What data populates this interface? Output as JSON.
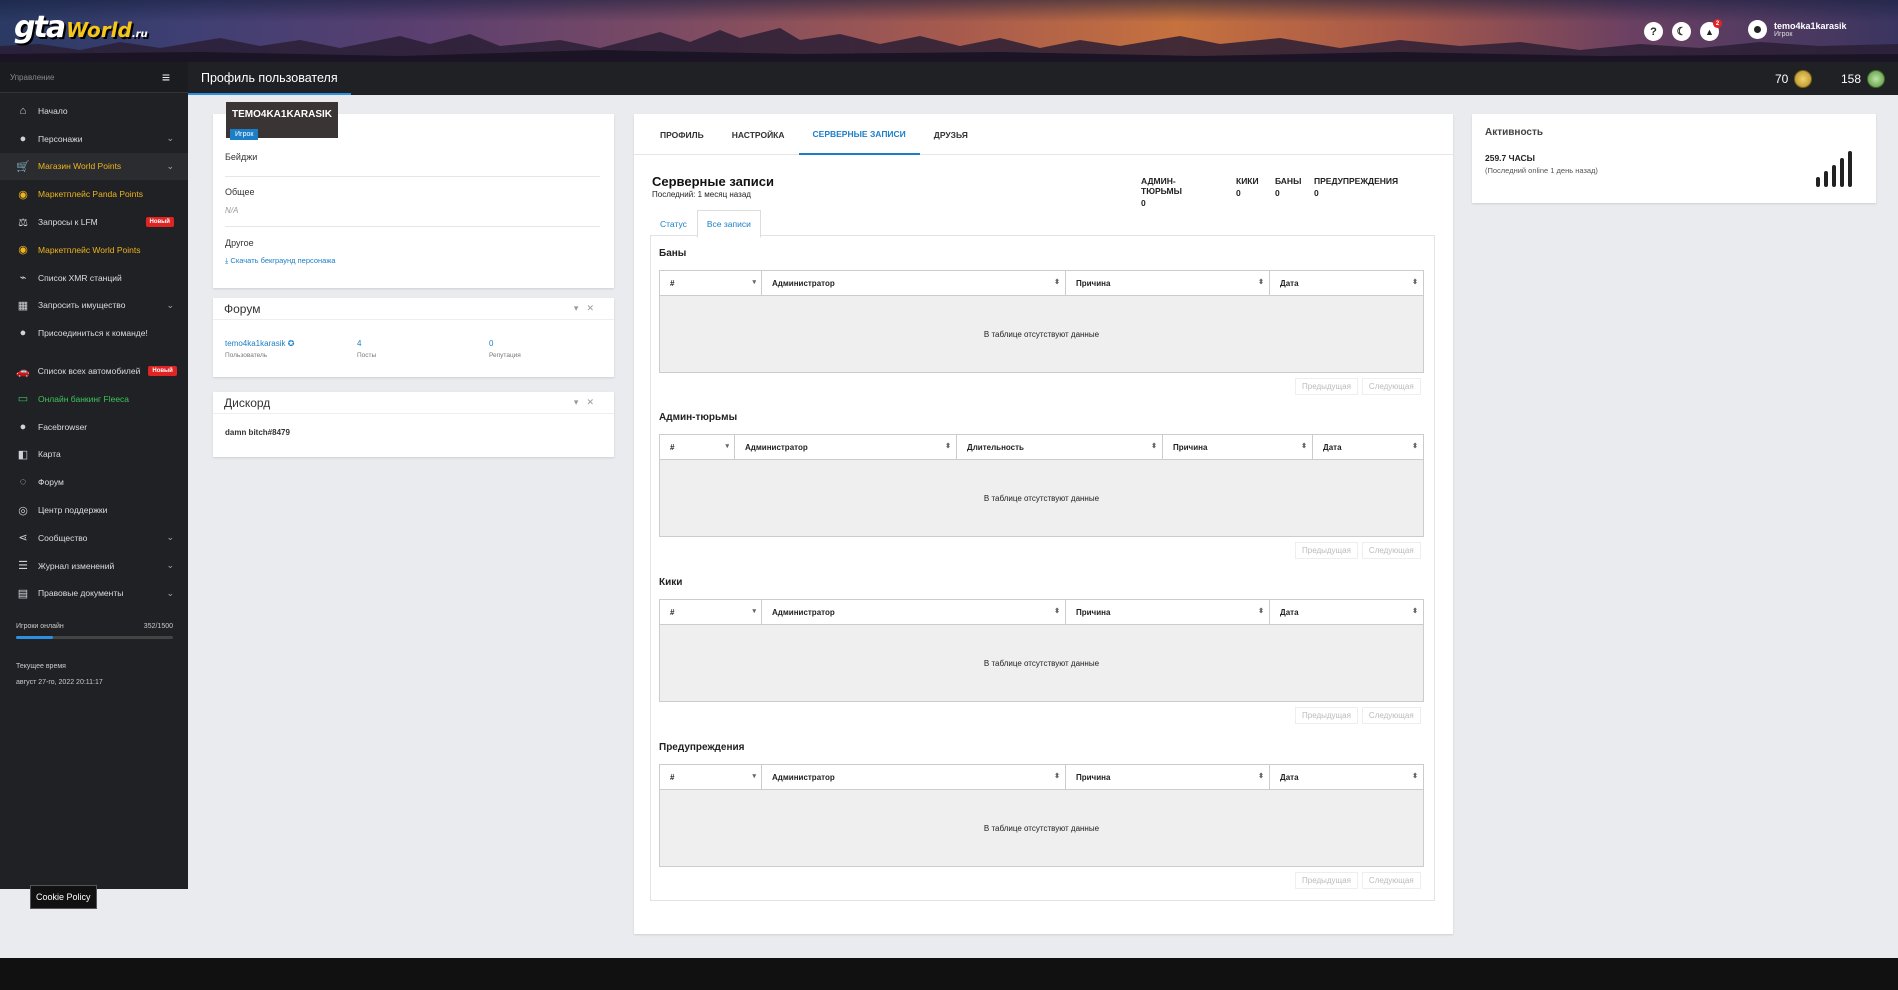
{
  "header": {
    "logo_main": "gta",
    "logo_world": "World",
    "logo_ru": ".ru",
    "icons": [
      {
        "name": "help-icon",
        "glyph": "?"
      },
      {
        "name": "moon-icon",
        "glyph": "☾"
      },
      {
        "name": "bell-icon",
        "glyph": "🔔",
        "badge": "2"
      }
    ],
    "user": {
      "name": "temo4ka1karasik",
      "role": "Игрок"
    }
  },
  "sidebar": {
    "header_label": "Управление",
    "menu_icon": "≡",
    "items": [
      {
        "label": "Начало",
        "icon": "home-icon",
        "glyph": "⌂",
        "chev": "",
        "badge": "",
        "style": ""
      },
      {
        "label": "Персонажи",
        "icon": "user-icon",
        "glyph": "●",
        "chev": "⌄",
        "badge": "",
        "style": ""
      },
      {
        "label": "Магазин World Points",
        "icon": "cart-icon",
        "glyph": "🛒",
        "chev": "⌄",
        "badge": "",
        "style": "gold active"
      },
      {
        "label": "Маркетплейс Panda Points",
        "icon": "coins-icon",
        "glyph": "◉",
        "chev": "",
        "badge": "",
        "style": "gold"
      },
      {
        "label": "Запросы к LFM",
        "icon": "scales-icon",
        "glyph": "⚖",
        "chev": "",
        "badge": "Новый",
        "style": ""
      },
      {
        "label": "Маркетплейс World Points",
        "icon": "coins-icon",
        "glyph": "◉",
        "chev": "",
        "badge": "",
        "style": "gold"
      },
      {
        "label": "Список XMR станций",
        "icon": "antenna-icon",
        "glyph": "⌁",
        "chev": "",
        "badge": "",
        "style": ""
      },
      {
        "label": "Запросить имущество",
        "icon": "building-icon",
        "glyph": "▦",
        "chev": "⌄",
        "badge": "",
        "style": ""
      },
      {
        "label": "Присоединиться к команде!",
        "icon": "user-plus-icon",
        "glyph": "●",
        "chev": "",
        "badge": "",
        "style": ""
      }
    ],
    "items2": [
      {
        "label": "Список всех автомобилей",
        "icon": "car-icon",
        "glyph": "🚗",
        "chev": "",
        "badge": "Новый",
        "style": ""
      },
      {
        "label": "Онлайн банкинг Fleeca",
        "icon": "money-icon",
        "glyph": "▭",
        "chev": "",
        "badge": "",
        "style": "green"
      },
      {
        "label": "Facebrowser",
        "icon": "users-icon",
        "glyph": "●",
        "chev": "",
        "badge": "",
        "style": ""
      },
      {
        "label": "Карта",
        "icon": "map-icon",
        "glyph": "◧",
        "chev": "",
        "badge": "",
        "style": ""
      },
      {
        "label": "Форум",
        "icon": "comments-icon",
        "glyph": "◌",
        "chev": "",
        "badge": "",
        "style": ""
      },
      {
        "label": "Центр поддержки",
        "icon": "support-icon",
        "glyph": "◎",
        "chev": "",
        "badge": "",
        "style": ""
      },
      {
        "label": "Сообщество",
        "icon": "share-icon",
        "glyph": "⋖",
        "chev": "⌄",
        "badge": "",
        "style": ""
      },
      {
        "label": "Журнал изменений",
        "icon": "list-icon",
        "glyph": "☰",
        "chev": "⌄",
        "badge": "",
        "style": ""
      },
      {
        "label": "Правовые документы",
        "icon": "document-icon",
        "glyph": "▤",
        "chev": "⌄",
        "badge": "",
        "style": ""
      }
    ],
    "online_label": "Игроки онлайн",
    "online_count": "352/1500",
    "online_fraction": 0.2347,
    "time_label": "Текущее время",
    "time_value": "август 27-го, 2022 20:11:17"
  },
  "cookie": "Cookie Policy",
  "titlebar": {
    "title": "Профиль пользователя",
    "stat1": "70",
    "stat2": "158"
  },
  "profile": {
    "name": "TEMO4KA1KARASIK",
    "role": "Игрок",
    "badges_label": "Бейджи",
    "general_label": "Общее",
    "general_value": "N/A",
    "other_label": "Другое",
    "download_link": "Скачать бекграунд персонажа"
  },
  "forum": {
    "title": "Форум",
    "user": "temo4ka1karasik",
    "user_label": "Пользователь",
    "posts": "4",
    "posts_label": "Посты",
    "rep": "0",
    "rep_label": "Репутация"
  },
  "discord": {
    "title": "Дискорд",
    "value": "damn bitch#8479"
  },
  "tabs": [
    "ПРОФИЛЬ",
    "НАСТРОЙКА",
    "СЕРВЕРНЫЕ ЗАПИСИ",
    "ДРУЗЬЯ"
  ],
  "records": {
    "title": "Серверные записи",
    "last": "Последний: 1 месяц назад",
    "stats": [
      {
        "label": "АДМИН-ТЮРЬМЫ",
        "value": "0"
      },
      {
        "label": "КИКИ",
        "value": "0"
      },
      {
        "label": "БАНЫ",
        "value": "0"
      },
      {
        "label": "ПРЕДУПРЕЖДЕНИЯ",
        "value": "0"
      }
    ],
    "subtabs": [
      "Статус",
      "Все записи"
    ],
    "empty": "В таблице отсутствуют данные",
    "prev": "Предыдущая",
    "next": "Следующая",
    "bans": {
      "title": "Баны",
      "cols": [
        "#",
        "Администратор",
        "Причина",
        "Дата"
      ]
    },
    "jails": {
      "title": "Админ-тюрьмы",
      "cols": [
        "#",
        "Администратор",
        "Длительность",
        "Причина",
        "Дата"
      ]
    },
    "kicks": {
      "title": "Кики",
      "cols": [
        "#",
        "Администратор",
        "Причина",
        "Дата"
      ]
    },
    "warns": {
      "title": "Предупреждения",
      "cols": [
        "#",
        "Администратор",
        "Причина",
        "Дата"
      ]
    }
  },
  "activity": {
    "title": "Активность",
    "hours": "259.7 ЧАСЫ",
    "last_online": "(Последний online 1 день назад)"
  }
}
